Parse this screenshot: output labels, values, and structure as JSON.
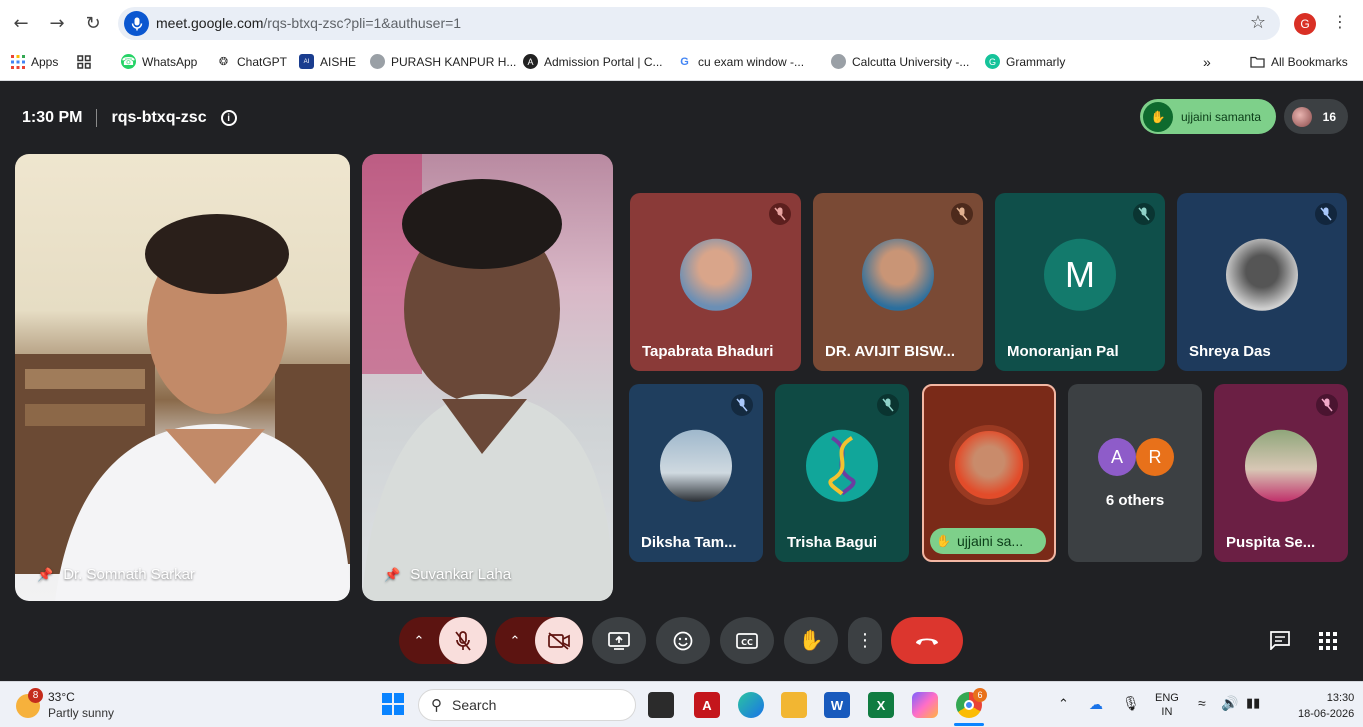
{
  "browser": {
    "url_host": "meet.google.com",
    "url_path": "/rqs-btxq-zsc?pli=1&authuser=1",
    "profile_initial": "G",
    "bookmarks": [
      {
        "label": "Apps",
        "icon": "apps-grid-icon"
      },
      {
        "label": "",
        "icon": "grid-icon"
      },
      {
        "label": "WhatsApp",
        "icon": "whatsapp-icon"
      },
      {
        "label": "ChatGPT",
        "icon": "chatgpt-icon"
      },
      {
        "label": "AISHE",
        "icon": "aishe-icon"
      },
      {
        "label": "PURASH KANPUR H...",
        "icon": "globe-icon"
      },
      {
        "label": "Admission Portal | C...",
        "icon": "admission-icon"
      },
      {
        "label": "cu exam window -...",
        "icon": "google-icon"
      },
      {
        "label": "Calcutta University -...",
        "icon": "globe-icon"
      },
      {
        "label": "Grammarly",
        "icon": "grammarly-icon"
      }
    ],
    "more_bookmarks": "»",
    "all_bookmarks": "All Bookmarks"
  },
  "meet": {
    "time": "1:30 PM",
    "meeting_code": "rqs-btxq-zsc",
    "raised_hand_name": "ujjaini samanta",
    "participant_count": "16",
    "pinned_videos": [
      {
        "name": "Dr. Somnath Sarkar"
      },
      {
        "name": "Suvankar Laha"
      }
    ],
    "tiles": [
      {
        "name": "Tapabrata Bhaduri",
        "bg": "#8a3a38",
        "muted": true
      },
      {
        "name": "DR. AVIJIT BISW...",
        "bg": "#7a4a35",
        "muted": true
      },
      {
        "name": "Monoranjan Pal",
        "bg": "#0f4f4a",
        "muted": true,
        "initial": "M"
      },
      {
        "name": "Shreya Das",
        "bg": "#1e3a5c",
        "muted": true
      },
      {
        "name": "Diksha Tam...",
        "bg": "#1f3e5e",
        "muted": true
      },
      {
        "name": "Trisha Bagui",
        "bg": "#0f4a44",
        "muted": true
      },
      {
        "name": "ujjaini sa...",
        "bg": "#7a2a18",
        "muted": false
      },
      {
        "name": "6 others",
        "bg": "#3c4043",
        "avatars": [
          "A",
          "R"
        ]
      },
      {
        "name": "Puspita Se...",
        "bg": "#6b1f44",
        "muted": true
      }
    ]
  },
  "taskbar": {
    "temperature": "33°C",
    "condition": "Partly sunny",
    "weather_badge": "8",
    "search_placeholder": "Search",
    "language": "ENG",
    "region": "IN",
    "time": "13:30",
    "date": "18-06-2026",
    "chrome_badge": "6"
  }
}
